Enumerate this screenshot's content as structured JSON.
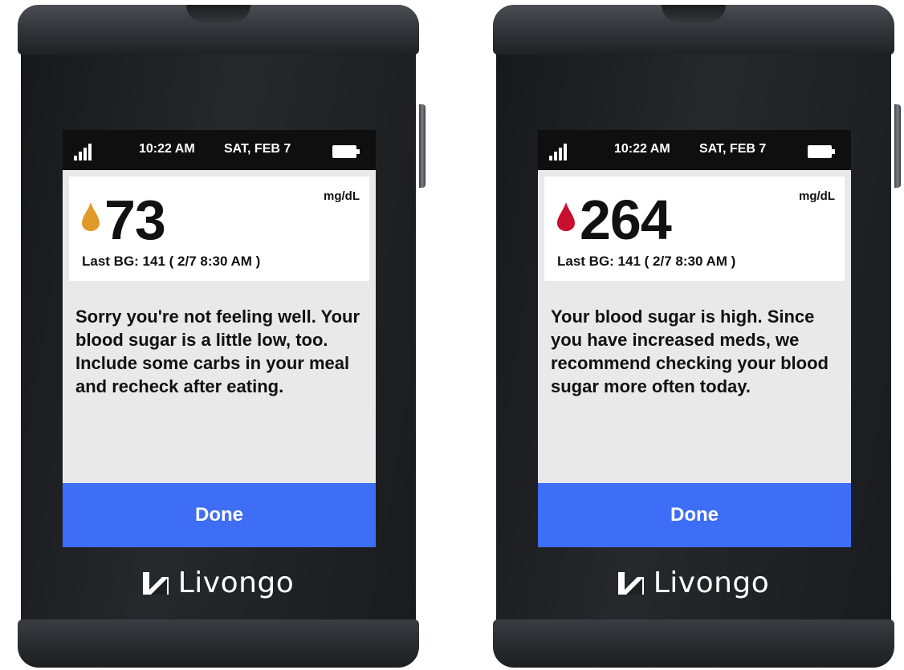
{
  "devices": [
    {
      "status": {
        "time": "10:22 AM",
        "date": "SAT, FEB 7"
      },
      "reading": {
        "value": "73",
        "unit": "mg/dL",
        "last_bg": "Last BG: 141 ( 2/7 8:30 AM )",
        "drop_color": "#e09a2a"
      },
      "message": "Sorry you're not feeling well. Your blood sugar is a little low, too. Include some carbs in your meal and recheck after eating.",
      "done_label": "Done",
      "brand": "Livongo",
      "icons": {
        "signal": "signal-icon",
        "battery": "battery-icon",
        "drop": "blood-drop-icon",
        "logo": "livongo-logo-icon"
      }
    },
    {
      "status": {
        "time": "10:22 AM",
        "date": "SAT, FEB 7"
      },
      "reading": {
        "value": "264",
        "unit": "mg/dL",
        "last_bg": "Last BG: 141 ( 2/7 8:30 AM )",
        "drop_color": "#c8102e"
      },
      "message": "Your blood sugar is high. Since you have increased meds, we recommend checking your blood sugar more often today.",
      "done_label": "Done",
      "brand": "Livongo",
      "icons": {
        "signal": "signal-icon",
        "battery": "battery-icon",
        "drop": "blood-drop-icon",
        "logo": "livongo-logo-icon"
      }
    }
  ],
  "colors": {
    "accent": "#3e6ef5",
    "screen_bg": "#e9e9e9",
    "status_bar": "#0f0f10"
  }
}
